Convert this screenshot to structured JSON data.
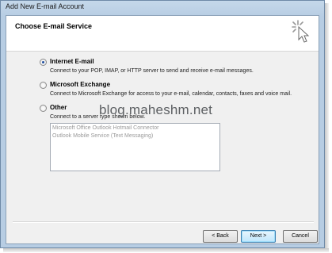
{
  "window": {
    "title": "Add New E-mail Account"
  },
  "header": {
    "title": "Choose E-mail Service",
    "icon": "wizard-cursor-icon"
  },
  "options": [
    {
      "label": "Internet E-mail",
      "description": "Connect to your POP, IMAP, or HTTP server to send and receive e-mail messages.",
      "selected": true
    },
    {
      "label": "Microsoft Exchange",
      "description": "Connect to Microsoft Exchange for access to your e-mail, calendar, contacts, faxes and voice mail.",
      "selected": false
    },
    {
      "label": "Other",
      "description": "Connect to a server type shown below.",
      "selected": false
    }
  ],
  "other_list": {
    "items": [
      "Microsoft Office Outlook Hotmail Connector",
      "Outlook Mobile Service (Text Messaging)"
    ]
  },
  "watermark": "blog.maheshm.net",
  "buttons": {
    "back": "< Back",
    "next": "Next >",
    "cancel": "Cancel"
  },
  "colors": {
    "frame": "#b7cde3",
    "accent": "#1f4ea0"
  }
}
